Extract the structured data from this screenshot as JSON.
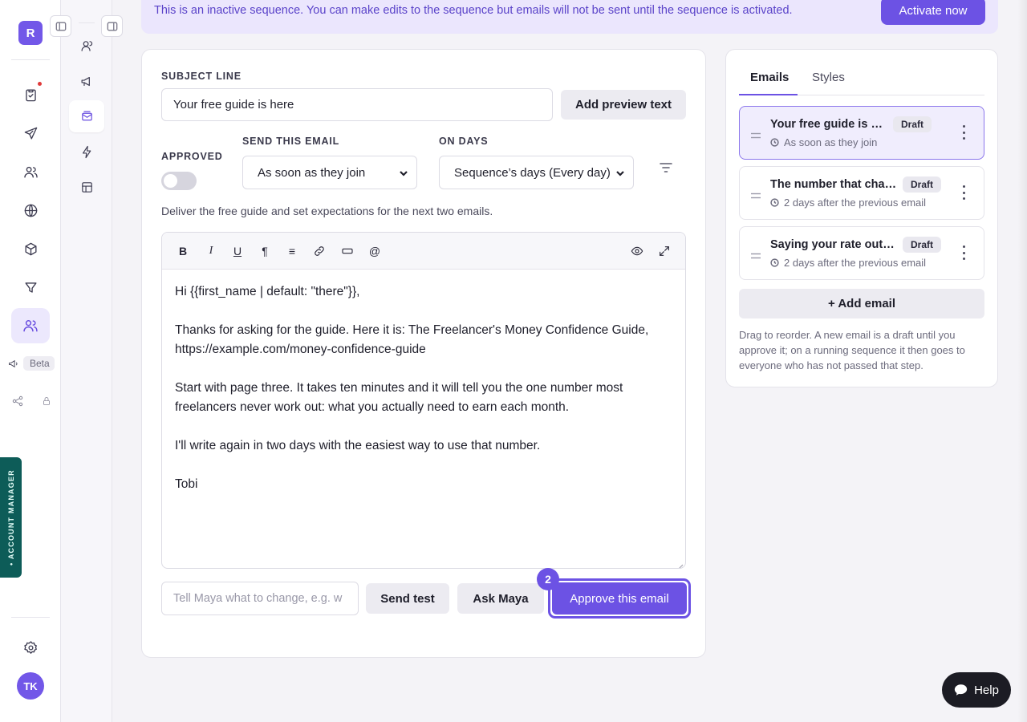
{
  "nav": {
    "logo_letter": "R",
    "beta_label": "Beta",
    "account_manager_label": "• ACCOUNT MANAGER",
    "avatar_initials": "TK",
    "primary_icons": [
      "clipboard-icon",
      "send-icon",
      "people-icon",
      "globe-icon",
      "box-icon",
      "funnel-icon",
      "contacts-icon",
      "megaphone-icon",
      "share-icon",
      "lock-icon",
      "settings-icon"
    ],
    "secondary_icons": [
      "person-icon",
      "megaphone-icon",
      "mail-sequence-icon",
      "lightning-icon",
      "layout-icon"
    ]
  },
  "banner": {
    "message": "This is an inactive sequence. You can make edits to the sequence but emails will not be sent until the sequence is activated.",
    "activate_label": "Activate now"
  },
  "editor": {
    "subject_label": "SUBJECT LINE",
    "subject_value": "Your free guide is here",
    "preview_button": "Add preview text",
    "approved_label": "APPROVED",
    "approved": false,
    "send_label": "SEND THIS EMAIL",
    "send_value": "As soon as they join",
    "days_label": "ON DAYS",
    "days_value": "Sequence’s days (Every day)",
    "description": "Deliver the free guide and set expectations for the next two emails.",
    "toolbar": {
      "bold": "B",
      "italic": "I",
      "underline": "U",
      "paragraph": "¶",
      "list": "≡",
      "link": "🔗",
      "button": "▭",
      "mention": "@"
    },
    "body_lines": [
      "Hi {{first_name | default: \"there\"}},",
      "",
      "Thanks for asking for the guide. Here it is: The Freelancer's Money Confidence Guide,",
      "https://example.com/money-confidence-guide",
      "",
      "Start with page three. It takes ten minutes and it will tell you the one number most",
      "freelancers never work out: what you actually need to earn each month.",
      "",
      "I'll write again in two days with the easiest way to use that number.",
      "",
      "Tobi"
    ],
    "maya_placeholder": "Tell Maya what to change, e.g. w",
    "send_test_label": "Send test",
    "ask_maya_label": "Ask Maya",
    "approve_label": "Approve this email",
    "step_number": "2"
  },
  "sidebar": {
    "tabs": [
      "Emails",
      "Styles"
    ],
    "active_tab": "Emails",
    "emails": [
      {
        "title": "Your free guide is here",
        "status": "Draft",
        "timing": "As soon as they join",
        "selected": true
      },
      {
        "title": "The number that chan…",
        "status": "Draft",
        "timing": "2 days after the previous email",
        "selected": false
      },
      {
        "title": "Saying your rate out l…",
        "status": "Draft",
        "timing": "2 days after the previous email",
        "selected": false
      }
    ],
    "add_label": "+ Add email",
    "help_text": "Drag to reorder. A new email is a draft until you approve it; on a running sequence it then goes to everyone who has not passed that step."
  },
  "help_button": "Help",
  "colors": {
    "accent": "#6c52e4",
    "banner_bg": "#ebe6fd",
    "account_tab": "#0d5c58"
  }
}
